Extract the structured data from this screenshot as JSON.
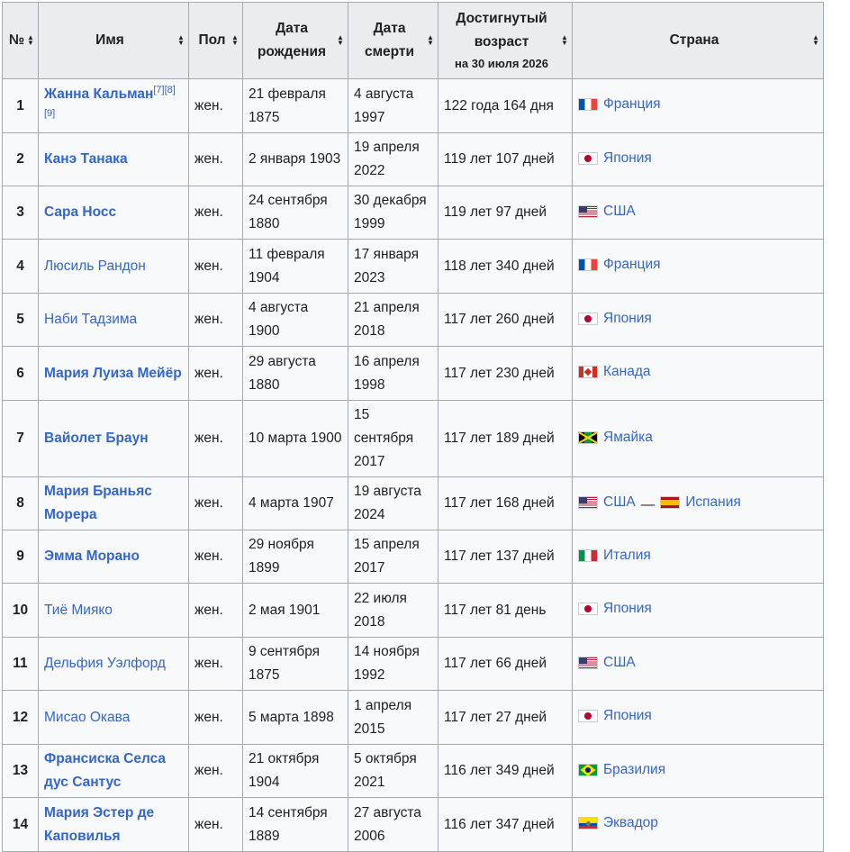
{
  "headers": {
    "num": "№",
    "name": "Имя",
    "sex": "Пол",
    "birth": "Дата рождения",
    "death": "Дата смерти",
    "age": "Достигнутый возраст",
    "age_sub": "на 30 июля 2026",
    "country": "Страна"
  },
  "sort_icon": "sort-arrows-icon",
  "colors": {
    "link": "#3366cc",
    "header_bg": "#eaecf0",
    "cell_bg": "#f8f9fa",
    "border": "#a2a9b1"
  },
  "rows": [
    {
      "num": "1",
      "name": "Жанна Кальман",
      "bold": true,
      "refs": "[7][8][9]",
      "sex": "жен.",
      "birth": "21 февраля 1875",
      "death": "4 августа 1997",
      "age": "122 года 164 дня",
      "countries": [
        {
          "flag": "fr",
          "name": "Франция"
        }
      ]
    },
    {
      "num": "2",
      "name": "Канэ Танака",
      "bold": true,
      "refs": "",
      "sex": "жен.",
      "birth": "2 января 1903",
      "death": "19 апреля 2022",
      "age": "119 лет 107 дней",
      "countries": [
        {
          "flag": "jp",
          "name": "Япония"
        }
      ]
    },
    {
      "num": "3",
      "name": "Сара Носс",
      "bold": true,
      "refs": "",
      "sex": "жен.",
      "birth": "24 сентября 1880",
      "death": "30 декабря 1999",
      "age": "119 лет 97 дней",
      "countries": [
        {
          "flag": "us",
          "name": "США"
        }
      ]
    },
    {
      "num": "4",
      "name": "Люсиль Рандон",
      "bold": false,
      "refs": "",
      "sex": "жен.",
      "birth": "11 февраля 1904",
      "death": "17 января 2023",
      "age": "118 лет 340 дней",
      "countries": [
        {
          "flag": "fr",
          "name": "Франция"
        }
      ]
    },
    {
      "num": "5",
      "name": "Наби Тадзима",
      "bold": false,
      "refs": "",
      "sex": "жен.",
      "birth": "4 августа 1900",
      "death": "21 апреля 2018",
      "age": "117 лет 260 дней",
      "countries": [
        {
          "flag": "jp",
          "name": "Япония"
        }
      ]
    },
    {
      "num": "6",
      "name": "Мария Луиза Мейёр",
      "bold": true,
      "refs": "",
      "sex": "жен.",
      "birth": "29 августа 1880",
      "death": "16 апреля 1998",
      "age": "117 лет 230 дней",
      "countries": [
        {
          "flag": "ca",
          "name": "Канада"
        }
      ]
    },
    {
      "num": "7",
      "name": "Вайолет Браун",
      "bold": true,
      "refs": "",
      "sex": "жен.",
      "birth": "10 марта 1900",
      "death": "15 сентября 2017",
      "age": "117 лет 189 дней",
      "countries": [
        {
          "flag": "jm",
          "name": "Ямайка"
        }
      ]
    },
    {
      "num": "8",
      "name": "Мария Браньяс Морера",
      "bold": true,
      "refs": "",
      "sex": "жен.",
      "birth": "4 марта 1907",
      "death": "19 августа 2024",
      "age": "117 лет 168 дней",
      "countries": [
        {
          "flag": "us",
          "name": "США"
        },
        {
          "flag": "es",
          "name": "Испания"
        }
      ],
      "separator": "—"
    },
    {
      "num": "9",
      "name": "Эмма Морано",
      "bold": true,
      "refs": "",
      "sex": "жен.",
      "birth": "29 ноября 1899",
      "death": "15 апреля 2017",
      "age": "117 лет 137 дней",
      "countries": [
        {
          "flag": "it",
          "name": "Италия"
        }
      ]
    },
    {
      "num": "10",
      "name": "Тиё Мияко",
      "bold": false,
      "refs": "",
      "sex": "жен.",
      "birth": "2 мая 1901",
      "death": "22 июля 2018",
      "age": "117 лет 81 день",
      "countries": [
        {
          "flag": "jp",
          "name": "Япония"
        }
      ]
    },
    {
      "num": "11",
      "name": "Дельфия Уэлфорд",
      "bold": false,
      "refs": "",
      "sex": "жен.",
      "birth": "9 сентября 1875",
      "death": "14 ноября 1992",
      "age": "117 лет 66 дней",
      "countries": [
        {
          "flag": "us",
          "name": "США"
        }
      ]
    },
    {
      "num": "12",
      "name": "Мисао Окава",
      "bold": false,
      "refs": "",
      "sex": "жен.",
      "birth": "5 марта 1898",
      "death": "1 апреля 2015",
      "age": "117 лет 27 дней",
      "countries": [
        {
          "flag": "jp",
          "name": "Япония"
        }
      ]
    },
    {
      "num": "13",
      "name": "Франсиска Селса дус Сантус",
      "bold": true,
      "refs": "",
      "sex": "жен.",
      "birth": "21 октября 1904",
      "death": "5 октября 2021",
      "age": "116 лет 349 дней",
      "countries": [
        {
          "flag": "br",
          "name": "Бразилия"
        }
      ]
    },
    {
      "num": "14",
      "name": "Мария Эстер де Каповилья",
      "bold": true,
      "refs": "",
      "sex": "жен.",
      "birth": "14 сентября 1889",
      "death": "27 августа 2006",
      "age": "116 лет 347 дней",
      "countries": [
        {
          "flag": "ec",
          "name": "Эквадор"
        }
      ]
    }
  ]
}
